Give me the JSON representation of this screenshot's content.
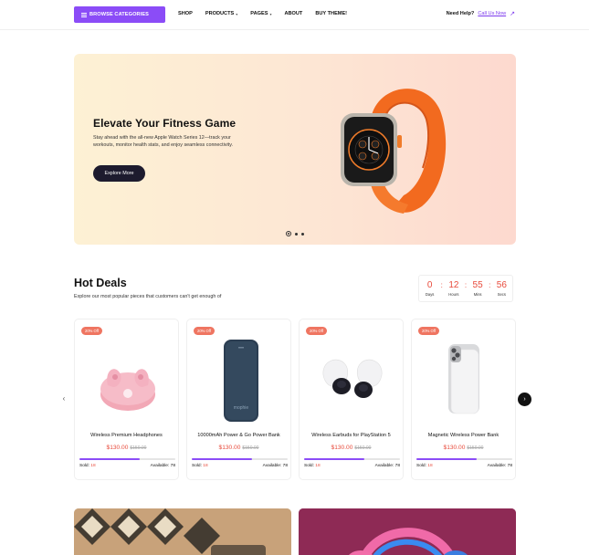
{
  "header": {
    "browse_label": "BROWSE CATEGORIES",
    "nav": [
      "SHOP",
      "PRODUCTS",
      "PAGES",
      "ABOUT",
      "BUY THEME!"
    ],
    "help_label": "Need Help?",
    "call_label": "Call Us Now"
  },
  "hero": {
    "title": "Elevate Your Fitness Game",
    "description": "Stay ahead with the all-new Apple Watch Series 12—track your workouts, monitor health stats, and enjoy seamless connectivity.",
    "button": "Explore More",
    "slides": 3,
    "active_slide": 1
  },
  "deals": {
    "title": "Hot Deals",
    "subtitle": "Explore our most popular pieces that customers can't get enough of",
    "countdown": [
      {
        "value": "0",
        "label": "Days"
      },
      {
        "value": "12",
        "label": "Hours"
      },
      {
        "value": "55",
        "label": "Mins"
      },
      {
        "value": "56",
        "label": "Secs"
      }
    ],
    "products": [
      {
        "badge": "20% Off",
        "name": "Wireless Premium Headphones",
        "price": "$130.00",
        "old_price": "$150.00",
        "sold_label": "Sold:",
        "sold": "18",
        "avail_label": "Available:",
        "available": "78",
        "progress": 0.63,
        "icon": "earbuds-pink-icon"
      },
      {
        "badge": "20% Off",
        "name": "10000mAh Power & Go Power Bank",
        "price": "$130.00",
        "old_price": "$150.00",
        "sold_label": "Sold:",
        "sold": "18",
        "avail_label": "Available:",
        "available": "78",
        "progress": 0.63,
        "icon": "power-bank-icon"
      },
      {
        "badge": "20% Off",
        "name": "Wireless Earbuds for PlayStation 5",
        "price": "$130.00",
        "old_price": "$150.00",
        "sold_label": "Sold:",
        "sold": "18",
        "avail_label": "Available:",
        "available": "78",
        "progress": 0.63,
        "icon": "earbuds-white-icon"
      },
      {
        "badge": "20% Off",
        "name": "Magnetic Wireless Power Bank",
        "price": "$130.00",
        "old_price": "$150.00",
        "sold_label": "Sold:",
        "sold": "18",
        "avail_label": "Available:",
        "available": "78",
        "progress": 0.63,
        "icon": "magsafe-powerbank-icon"
      }
    ]
  },
  "colors": {
    "accent": "#8b4cf7",
    "price": "#e84b3c",
    "badge": "#ef7561"
  }
}
